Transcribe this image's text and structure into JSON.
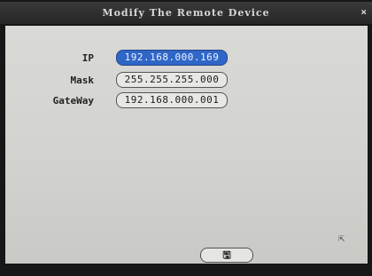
{
  "window": {
    "title": "Modify The Remote Device",
    "close_glyph": "×"
  },
  "form": {
    "fields": [
      {
        "label": "IP",
        "value": "192.168.000.169",
        "selected": true
      },
      {
        "label": "Mask",
        "value": "255.255.255.000",
        "selected": false
      },
      {
        "label": "GateWay",
        "value": "192.168.000.001",
        "selected": false
      }
    ]
  },
  "footer": {
    "save_icon": "save-icon",
    "save_glyph": "🖫"
  },
  "cursor": {
    "icon": "mouse-cursor-icon",
    "glyph": "⇱"
  }
}
